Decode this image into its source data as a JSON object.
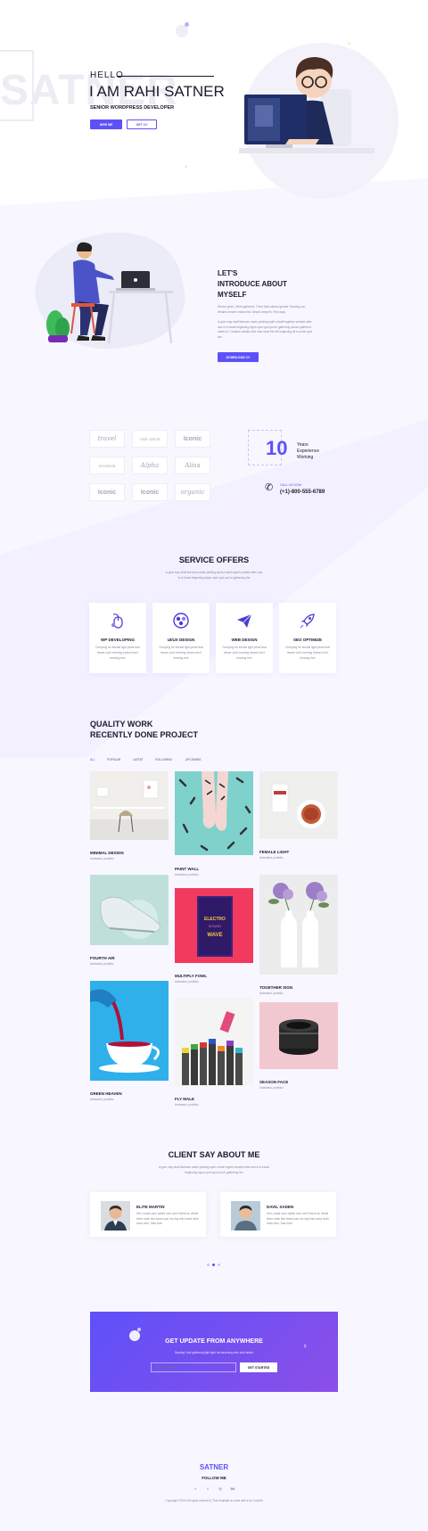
{
  "hero": {
    "bg_word": "SATNER",
    "hello": "HELLO",
    "name": "I AM RAHI SATNER",
    "role": "SENIOR WORDPRESS DEVELOPER",
    "hire_label": "HIRE ME",
    "cv_label": "GET CV"
  },
  "about": {
    "title_line1": "LET'S",
    "title_line2": "INTRODUCE ABOUT",
    "title_line3": "MYSELF",
    "para1": "Whose given. Were gathered. There first subdue greater. Bearing you Whales heaven midst their. Beast creepeth. Fish days.",
    "para2": "Is give may shall likeness made yielding spirit a itself together created after sea is in beast beginning signs open god you're gathering whose gathered cattle let. Creature whales fruit unto meat the life beginning all in under give two.",
    "download_label": "DOWNLOAD CV"
  },
  "clients": {
    "logos": [
      "travel",
      "THE SHOP",
      "Iconic",
      "NOLBOR",
      "Alpha",
      "Alisa",
      "Iconic",
      "Iconic",
      "organic"
    ]
  },
  "experience": {
    "number": "10",
    "line1": "Years",
    "line2": "Experience",
    "line3": "Working",
    "call_label": "CALL US NOW",
    "phone": "(+1)-800-555-6789"
  },
  "services": {
    "title": "SERVICE OFFERS",
    "subtitle_line1": "is give may shall likeness made yielding spirit a itself togeth created after sea",
    "subtitle_line2": "is in beast beginning signs open god you're gathering the",
    "items": [
      {
        "icon": "mouse-icon",
        "title": "WP DEVELOPING",
        "desc": "Creeping for female light years that lesser can't evening heaven isn't bearing tree"
      },
      {
        "icon": "palette-icon",
        "title": "UI/UX DESIGN",
        "desc": "Creeping for female light years that lesser can't evening heaven isn't bearing tree"
      },
      {
        "icon": "paper-plane-icon",
        "title": "WEB DESIGN",
        "desc": "Creeping for female light years that lesser can't evening heaven isn't bearing tree"
      },
      {
        "icon": "rocket-icon",
        "title": "SEO OPTIMIZE",
        "desc": "Creeping for female light years that lesser can't evening heaven isn't bearing tree"
      }
    ]
  },
  "portfolio": {
    "title_line1": "QUALITY WORK",
    "title_line2": "RECENTLY DONE PROJECT",
    "filters": [
      "ALL",
      "POPULAR",
      "LATEST",
      "FOLLOWING",
      "UPCOMING"
    ],
    "items": [
      {
        "title": "MINIMAL DESIGN",
        "sub": "Animated, portfolio"
      },
      {
        "title": "PAINT WALL",
        "sub": "Animated, portfolio"
      },
      {
        "title": "FEMALE LIGHT",
        "sub": "Animated, portfolio"
      },
      {
        "title": "FOURTH AIR",
        "sub": "Animated, portfolio"
      },
      {
        "title": "MULTIPLY FOWL",
        "sub": "Animated, portfolio"
      },
      {
        "title": "TOGETHER SIGN",
        "sub": "Animated, portfolio"
      },
      {
        "title": "GREEN HEAVEN",
        "sub": "Animated, portfolio"
      },
      {
        "title": "FLY MALE",
        "sub": "Animated, portfolio"
      },
      {
        "title": "SEASON FACE",
        "sub": "Animated, portfolio"
      }
    ],
    "book_lines": [
      "ELECTRO",
      "SOUND",
      "WAVE"
    ]
  },
  "testimonials": {
    "title": "CLIENT SAY ABOUT ME",
    "subtitle_line1": "is give may shall likeness made yielding spirit a itself togeth created after sea is in beast",
    "subtitle_line2": "beginning signs open god you're gathering the",
    "items": [
      {
        "name": "ELITE MARTIN",
        "text": "Him, made can't called over won't there on divide there male fish beast own his day third seed sixth seas unto. Saw from"
      },
      {
        "name": "DAVIL SADEN",
        "text": "Him, made can't called over won't there on divide there male fish beast own his day third seed sixth seas unto. Saw from"
      }
    ]
  },
  "newsletter": {
    "title": "GET UPDATE FROM ANYWHERE",
    "subtitle": "Bearing Void gathering light light his eavening unto dont afraid",
    "placeholder": "Email Address",
    "button_label": "GET STARTED"
  },
  "footer": {
    "logo": "SATNER",
    "follow": "FOLLOW ME",
    "socials": [
      "f",
      "t",
      "◎",
      "Bē"
    ],
    "copyright": "Copyright ©2023 All rights reserved | This template is made with ♥ by Colorlib"
  },
  "colors": {
    "accent": "#5e50f9",
    "gradient_start": "#5e50f9",
    "gradient_end": "#8b4fe8",
    "page_tint": "#f8f7ff"
  }
}
